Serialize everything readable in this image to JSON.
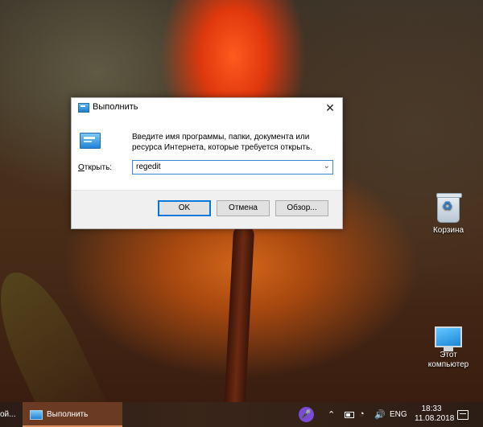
{
  "dialog": {
    "title": "Выполнить",
    "close_glyph": "✕",
    "description": "Введите имя программы, папки, документа или ресурса Интернета, которые требуется открыть.",
    "open_label_accel": "О",
    "open_label_rest": "ткрыть:",
    "open_value": "regedit",
    "combo_arrow": "⌄",
    "buttons": {
      "ok": "OK",
      "cancel": "Отмена",
      "browse": "Обзор..."
    }
  },
  "desktop": {
    "icons": [
      {
        "label": "Корзина",
        "icon": "recycle-bin-icon"
      },
      {
        "label": "Этот компьютер",
        "icon": "computer-icon"
      }
    ]
  },
  "taskbar": {
    "prev_label": "ой...",
    "active_app": "Выполнить",
    "mic_glyph": "🎤",
    "tray_up_glyph": "⌃",
    "network_glyph": "◔",
    "volume_glyph": "🔊",
    "language": "ENG",
    "time": "18:33",
    "date": "11.08.2018"
  }
}
